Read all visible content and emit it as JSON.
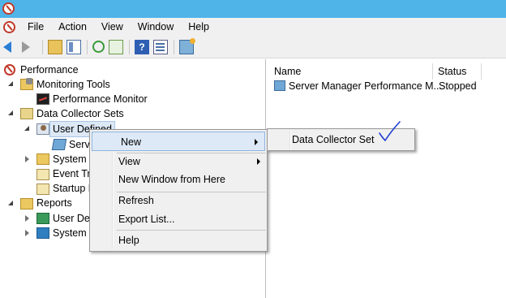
{
  "menubar": {
    "items": [
      "File",
      "Action",
      "View",
      "Window",
      "Help"
    ]
  },
  "toolbar": {
    "buttons": [
      "back-arrow-icon",
      "forward-arrow-icon",
      "up-folder-icon",
      "show-hide-tree-icon",
      "refresh-icon",
      "export-list-icon",
      "help-icon",
      "properties-icon",
      "action-pane-icon"
    ]
  },
  "tree": {
    "performance": "Performance",
    "monitoring_tools": "Monitoring Tools",
    "performance_monitor": "Performance Monitor",
    "data_collector_sets": "Data Collector Sets",
    "user_defined": "User Defined",
    "server": "Serve",
    "system": "System",
    "event_trace": "Event Tr",
    "startup": "Startup E",
    "reports": "Reports",
    "reports_user": "User Def",
    "reports_system": "System"
  },
  "list": {
    "columns": {
      "name": "Name",
      "status": "Status"
    },
    "rows": [
      {
        "name": "Server Manager Performance M...",
        "status": "Stopped"
      }
    ]
  },
  "context_menu": {
    "new": "New",
    "view": "View",
    "new_window": "New Window from Here",
    "refresh": "Refresh",
    "export_list": "Export List...",
    "help": "Help"
  },
  "submenu": {
    "data_collector_set": "Data Collector Set"
  },
  "colors": {
    "titlebar": "#4fb4e8",
    "menu_highlight": "#dde9f7",
    "check_annotation": "#1e3fd0"
  }
}
